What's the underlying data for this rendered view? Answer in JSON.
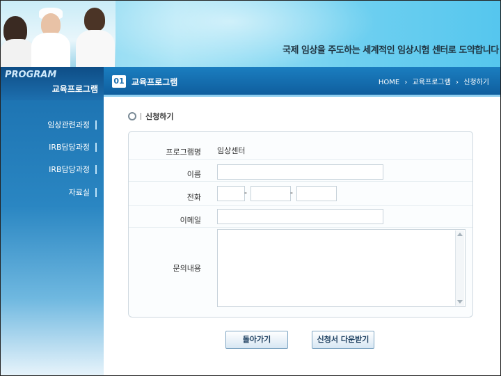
{
  "header": {
    "slogan": "국제 임상을 주도하는 세계적인 임상시험 센터로 도약합니다"
  },
  "sidebar": {
    "program_label": "PROGRAM",
    "title": "교육프로그램",
    "items": [
      {
        "label": "임상관련과정"
      },
      {
        "label": "IRB담당과정"
      },
      {
        "label": "IRB담당과정"
      },
      {
        "label": "자료실"
      }
    ]
  },
  "content": {
    "number": "01",
    "title": "교육프로그램",
    "breadcrumb": [
      "HOME",
      "›",
      "교육프로그램",
      "›",
      "신청하기"
    ]
  },
  "section": {
    "title": "신청하기"
  },
  "form": {
    "program_label": "프로그램명",
    "program_value": "임상센터",
    "name_label": "이름",
    "name_value": "",
    "phone_label": "전화",
    "phone_parts": [
      "",
      "",
      ""
    ],
    "phone_separator": "-",
    "email_label": "이메일",
    "email_value": "",
    "inquiry_label": "문의내용",
    "inquiry_value": ""
  },
  "buttons": {
    "back": "돌아가기",
    "download": "신청서 다운받기"
  },
  "colors": {
    "header_accent": "#55c6ee",
    "sidebar": "#1a6fae",
    "content_bar": "#1b7ec0"
  }
}
